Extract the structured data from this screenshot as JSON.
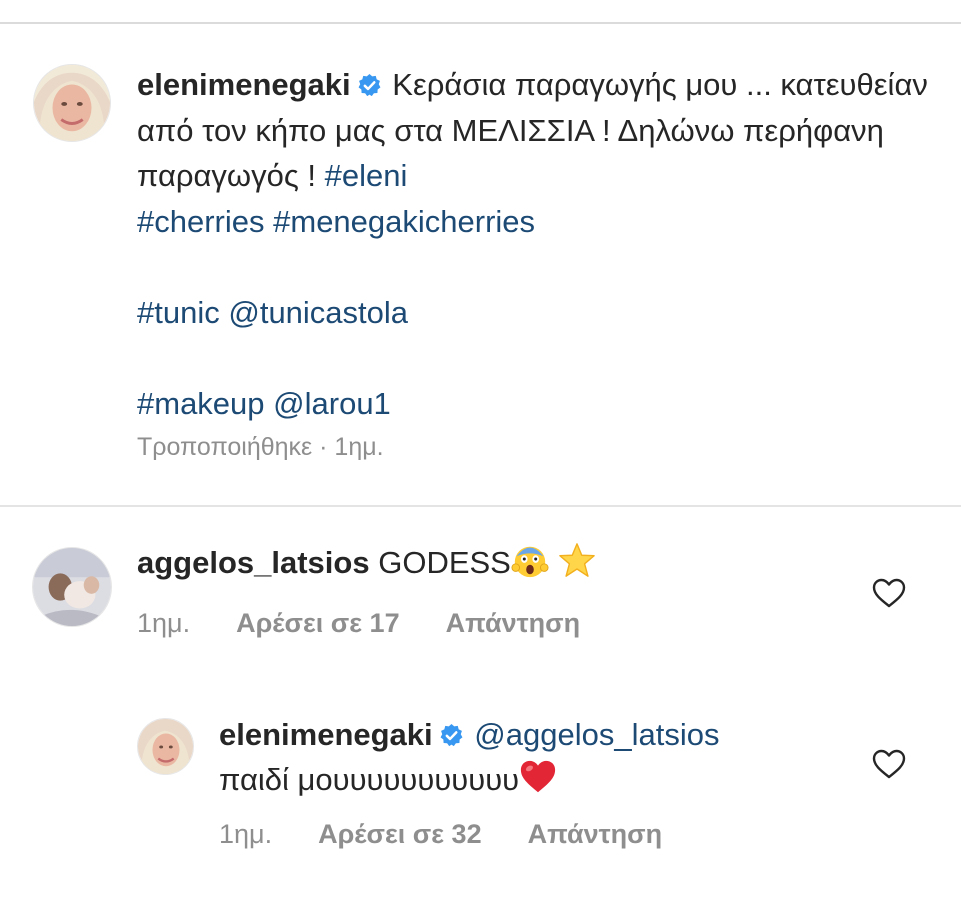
{
  "post": {
    "username": "elenimenegaki",
    "caption_text": "Κεράσια παραγωγής μου ... κατευθείαν από τον κήπο μας στα ΜΕΛΙΣΣΙΑ ! Δηλώνω περήφανη παραγωγός !",
    "tags_line1": [
      "#eleni"
    ],
    "tags_line2": [
      "#cherries",
      "#menegakicherries"
    ],
    "line_tunic": [
      "#tunic",
      "@tunicastola"
    ],
    "line_makeup": [
      "#makeup",
      "@larou1"
    ],
    "edited_label": "Τροποποιήθηκε · 1ημ."
  },
  "comments": [
    {
      "username": "aggelos_latsios",
      "text": "GODESS",
      "emojis": [
        "scream-emoji",
        "star-emoji"
      ],
      "time": "1ημ.",
      "likes": "Αρέσει σε 17",
      "reply": "Απάντηση"
    },
    {
      "username": "elenimenegaki",
      "mention": "@aggelos_latsios",
      "text": "παιδί μουυυυυυυυυυυ",
      "emojis": [
        "red-heart-emoji"
      ],
      "time": "1ημ.",
      "likes": "Αρέσει σε 32",
      "reply": "Απάντηση"
    }
  ],
  "colors": {
    "hashtag": "#1c4a75",
    "meta": "#8e8e8e",
    "verified": "#3897f0"
  }
}
